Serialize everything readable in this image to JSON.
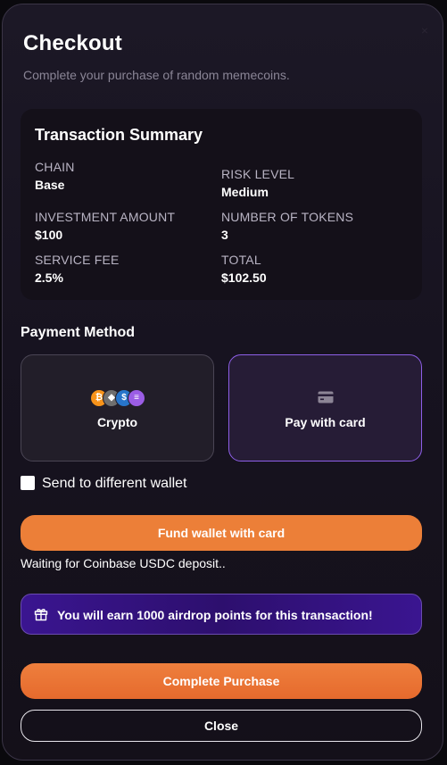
{
  "modal": {
    "close_glyph": "×",
    "title": "Checkout",
    "subtitle": "Complete your purchase of random memecoins."
  },
  "summary": {
    "title": "Transaction Summary",
    "chain": {
      "label": "CHAIN",
      "value": "Base"
    },
    "risk_level": {
      "label": "RISK LEVEL",
      "value": "Medium"
    },
    "investment_amount": {
      "label": "INVESTMENT AMOUNT",
      "value": "$100"
    },
    "number_of_tokens": {
      "label": "NUMBER OF TOKENS",
      "value": "3"
    },
    "service_fee": {
      "label": "SERVICE FEE",
      "value": "2.5%"
    },
    "total": {
      "label": "TOTAL",
      "value": "$102.50"
    }
  },
  "payment_method": {
    "title": "Payment Method",
    "options": [
      {
        "label": "Crypto",
        "icons": [
          "bitcoin-icon",
          "ethereum-icon",
          "usdc-icon",
          "solana-icon"
        ],
        "selected": false
      },
      {
        "label": "Pay with card",
        "icon": "credit-card-icon",
        "selected": true
      }
    ]
  },
  "wallet_option": {
    "label": "Send to different wallet",
    "checked": false
  },
  "fund_button": {
    "label": "Fund wallet with card"
  },
  "status": {
    "text": "Waiting for Coinbase USDC deposit.."
  },
  "airdrop_banner": {
    "icon": "gift-icon",
    "text": "You will earn 1000 airdrop points for this transaction!"
  },
  "complete_button": {
    "label": "Complete Purchase"
  },
  "close_button": {
    "label": "Close"
  },
  "colors": {
    "accent_orange": "#ec7f38",
    "selected_border": "#8e5fe8",
    "airdrop_bg": "#2d0f6e",
    "bitcoin": "#f7931a",
    "ethereum": "#8a8a8a",
    "usdc": "#2775ca",
    "solana": "#9b5de5"
  }
}
